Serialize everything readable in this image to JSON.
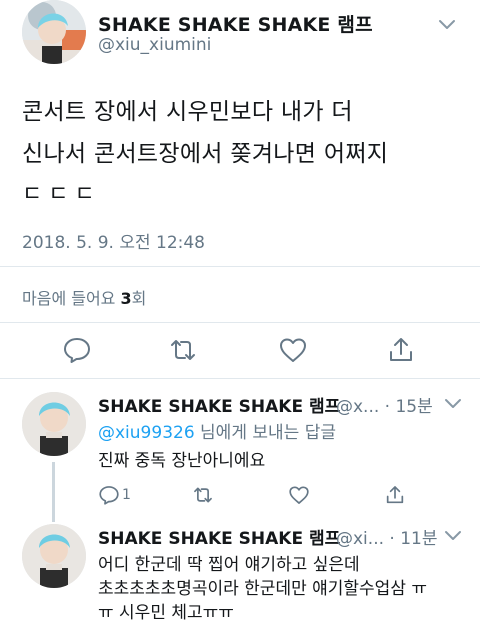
{
  "main_tweet": {
    "display_name": "SHAKE SHAKE SHAKE 램프",
    "handle": "@xiu_xiumini",
    "text_lines": [
      "콘서트 장에서 시우민보다 내가 더",
      "신나서 콘서트장에서  쫒겨나면 어쩌지",
      "ㄷㄷㄷ"
    ],
    "timestamp": "2018. 5. 9. 오전 12:48",
    "likes_label_prefix": "마음에 들어요 ",
    "likes_count": "3",
    "likes_label_suffix": "회",
    "actions": [
      "reply-icon",
      "retweet-icon",
      "like-icon",
      "share-icon"
    ]
  },
  "replies": [
    {
      "display_name": "SHAKE SHAKE SHAKE 램프",
      "handle_time": "@x... · 15분",
      "reply_to_handle": "@xiu99326",
      "reply_to_suffix": " 님에게 보내는 답글",
      "text_lines": [
        "진짜 중독 장난아니에요"
      ],
      "reply_count": "1"
    },
    {
      "display_name": "SHAKE SHAKE SHAKE 램프",
      "handle_time": "@xi... · 11분",
      "text_lines": [
        "어디 한군데 딱 찝어 얘기하고 싶은데",
        "초초초초초명곡이라 한군데만 얘기할수업삼 ㅠ",
        "ㅠ 시우민 체고ㅠㅠ"
      ]
    }
  ],
  "colors": {
    "accent": "#1da1f2",
    "secondary_text": "#657786",
    "divider": "#e1e8ed",
    "icon": "#657786"
  }
}
